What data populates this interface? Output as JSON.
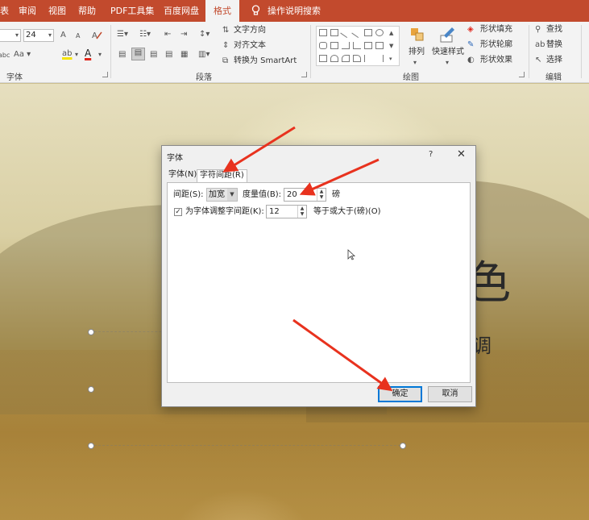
{
  "menubar": {
    "items": [
      "表",
      "审阅",
      "视图",
      "帮助",
      "PDF工具集",
      "百度网盘",
      "格式",
      "操作说明搜索"
    ],
    "active_index": 6
  },
  "ribbon": {
    "font": {
      "size": "24",
      "group_label": "字体",
      "grow_label": "A",
      "shrink_label": "A",
      "spacing_label": "abc",
      "highlight_label": "ab",
      "color_label": "A"
    },
    "paragraph": {
      "text_direction": "文字方向",
      "align_text": "对齐文本",
      "convert_smartart": "转换为 SmartArt",
      "group_label": "段落"
    },
    "drawing": {
      "arrange": "排列",
      "quick_styles": "快速样式",
      "shape_fill": "形状填充",
      "shape_outline": "形状轮廓",
      "shape_effects": "形状效果",
      "group_label": "绘图"
    },
    "editing": {
      "find": "查找",
      "replace": "替换",
      "select": "选择",
      "group_label": "编辑"
    }
  },
  "slide": {
    "big_char": "色",
    "sub_char": "调"
  },
  "dialog": {
    "title": "字体",
    "help": "?",
    "close": "✕",
    "tabs": [
      "字体(N)",
      "字符间距(R)"
    ],
    "selected_tab": 1,
    "spacing_label": "间距(S):",
    "spacing_value": "加宽",
    "by_label": "度量值(B):",
    "by_value": "20",
    "by_unit": "磅",
    "kerning_label": "为字体调整字间距(K):",
    "kerning_checked": true,
    "kerning_value": "12",
    "kerning_suffix": "等于或大于(磅)(O)",
    "ok": "确定",
    "cancel": "取消"
  },
  "colors": {
    "accent": "#c24a2d",
    "arrow": "#e8321e",
    "focus": "#0078d7"
  }
}
